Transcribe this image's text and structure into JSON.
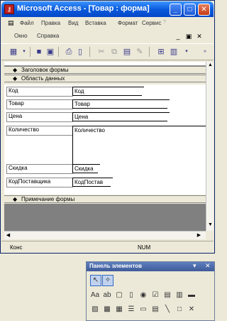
{
  "window": {
    "title": "Microsoft Access - [Товар : форма]",
    "app_icon": "access-key-icon",
    "accent": "#0a5bdc"
  },
  "menu": [
    {
      "label": "Файл"
    },
    {
      "label": "Правка"
    },
    {
      "label": "Вид"
    },
    {
      "label": "Вставка"
    },
    {
      "label": "Формат"
    },
    {
      "label": "Сервис"
    }
  ],
  "menu2": [
    {
      "label": "Окно"
    },
    {
      "label": "Справка"
    }
  ],
  "sections": {
    "header": "Заголовок формы",
    "detail": "Область данных",
    "footer": "Примечание формы"
  },
  "fields": [
    {
      "label": "Код",
      "control": "Код"
    },
    {
      "label": "Товар",
      "control": "Товар"
    },
    {
      "label": "Цена",
      "control": "Цена"
    },
    {
      "label": "Количество",
      "control": "Количество"
    },
    {
      "label": "Скидка",
      "control": "Скидка"
    },
    {
      "label": "КодПоставщика",
      "control": "КодПостав"
    }
  ],
  "status": {
    "mode": "Конс",
    "num": "NUM"
  },
  "toolbox": {
    "title": "Панель элементов"
  }
}
